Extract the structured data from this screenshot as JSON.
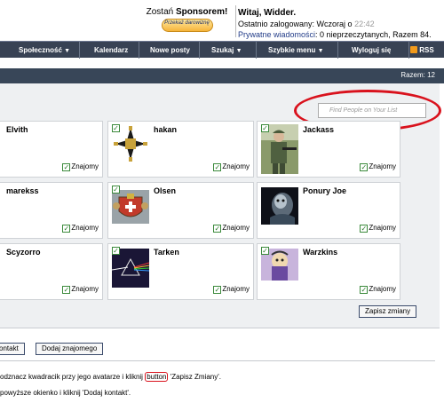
{
  "header": {
    "sponsor_text": "Zostań",
    "sponsor_bold": "Sponsorem!",
    "donate_button": "Przekaż darowiznę",
    "welcome_label": "Witaj,",
    "user_name": "Widder.",
    "last_login_label": "Ostatnio zalogowany: Wczoraj o",
    "last_login_time": "22:42",
    "pm_link": "Prywatne wiadomości",
    "pm_status": ": 0 nieprzeczytanych, Razem 84."
  },
  "nav": {
    "items": [
      {
        "label": "Społeczność",
        "dropdown": true
      },
      {
        "label": "Kalendarz",
        "dropdown": false
      },
      {
        "label": "Nowe posty",
        "dropdown": false
      },
      {
        "label": "Szukaj",
        "dropdown": true
      },
      {
        "label": "Szybkie menu",
        "dropdown": true
      },
      {
        "label": "Wyloguj się",
        "dropdown": false
      },
      {
        "label": "RSS",
        "dropdown": false
      }
    ]
  },
  "panel": {
    "count_text": "Razem: 12",
    "search_placeholder": "Find People on Your List",
    "friend_label": "Znajomy",
    "contacts": [
      {
        "name": "Elvith"
      },
      {
        "name": "hakan"
      },
      {
        "name": "Jackass"
      },
      {
        "name": "marekss"
      },
      {
        "name": "Olsen"
      },
      {
        "name": "Ponury Joe"
      },
      {
        "name": "Scyzorro"
      },
      {
        "name": "Tarken"
      },
      {
        "name": "Warzkins"
      }
    ],
    "save_button": "Zapisz zmiany"
  },
  "actions": {
    "contact_button": "ontakt",
    "add_friend_button": "Dodaj znajomego"
  },
  "hints": {
    "line1_before": "odznacz kwadracik przy jego avatarze i kliknij",
    "line1_highlight": "button",
    "line1_after": "'Zapisz Zmiany'.",
    "line2": "powyższe okienko i kliknij 'Dodaj kontakt'."
  },
  "colors": {
    "navbar_bg": "#384254",
    "panel_bg": "#eef0f2",
    "highlight_red": "#d9121d",
    "checkbox_green": "#3b8a3b"
  }
}
